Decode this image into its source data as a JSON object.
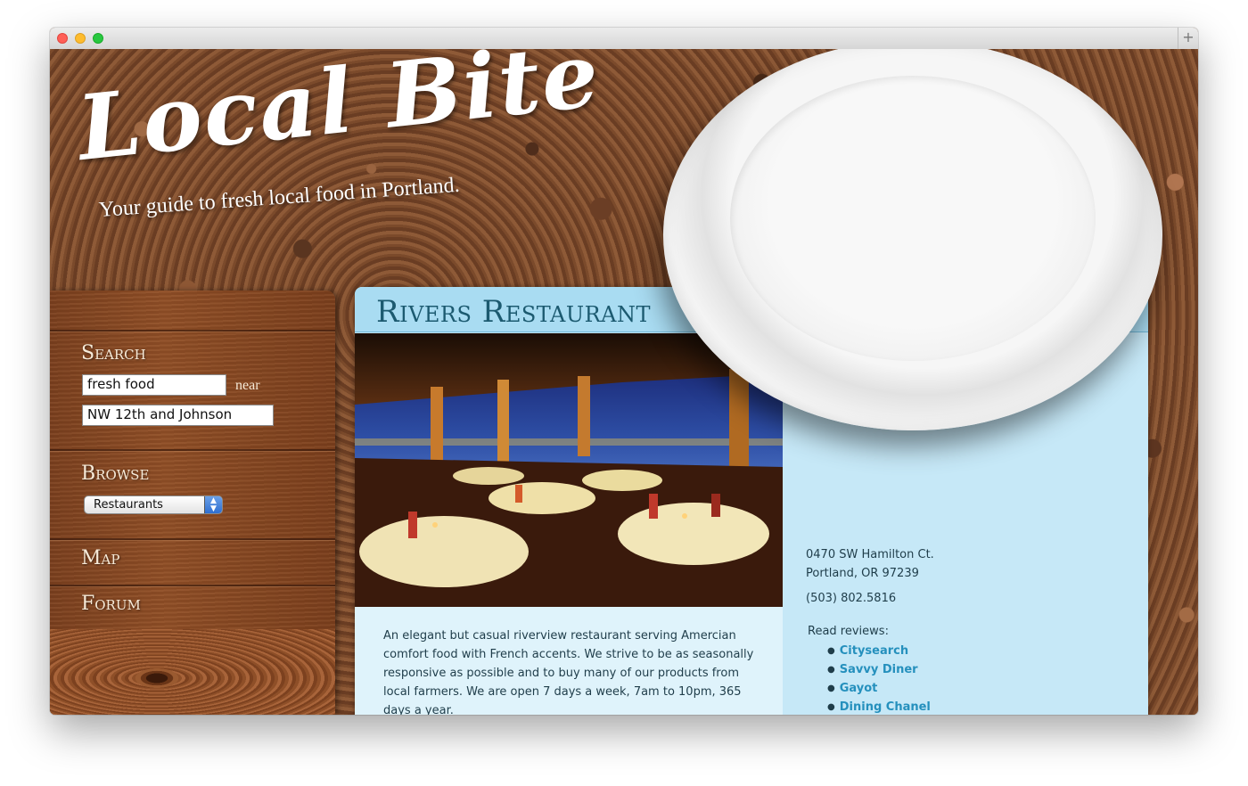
{
  "site": {
    "logo": "Local Bite",
    "tagline": "Your guide to fresh local food in Portland."
  },
  "sidebar": {
    "search": {
      "title": "Search",
      "query": "fresh food",
      "near_label": "near",
      "location": "NW 12th and Johnson"
    },
    "browse": {
      "title": "Browse",
      "selected": "Restaurants"
    },
    "nav": [
      {
        "label": "Map"
      },
      {
        "label": "Forum"
      }
    ]
  },
  "restaurant": {
    "name": "Rivers Restaurant",
    "description": "An elegant but casual riverview restaurant serving Amercian comfort food with French accents. We strive to be as seasonally responsive as possible and to buy many of our products from local farmers. We are open 7 days a week, 7am to 10pm, 365 days a year.",
    "address_line1": "0470 SW Hamilton Ct.",
    "address_line2": "Portland, OR 97239",
    "phone": "(503) 802.5816",
    "reviews_label": "Read reviews:",
    "reviews": [
      {
        "label": "Citysearch"
      },
      {
        "label": "Savvy Diner"
      },
      {
        "label": "Gayot"
      },
      {
        "label": "Dining Chanel"
      }
    ]
  },
  "colors": {
    "panel_bg": "#c6e8f7",
    "title": "#1c5a70",
    "link": "#2590bd",
    "wood": "#8f4e26"
  },
  "icons": {
    "select_arrows": "updown-arrows-icon",
    "new_tab": "plus-icon"
  }
}
